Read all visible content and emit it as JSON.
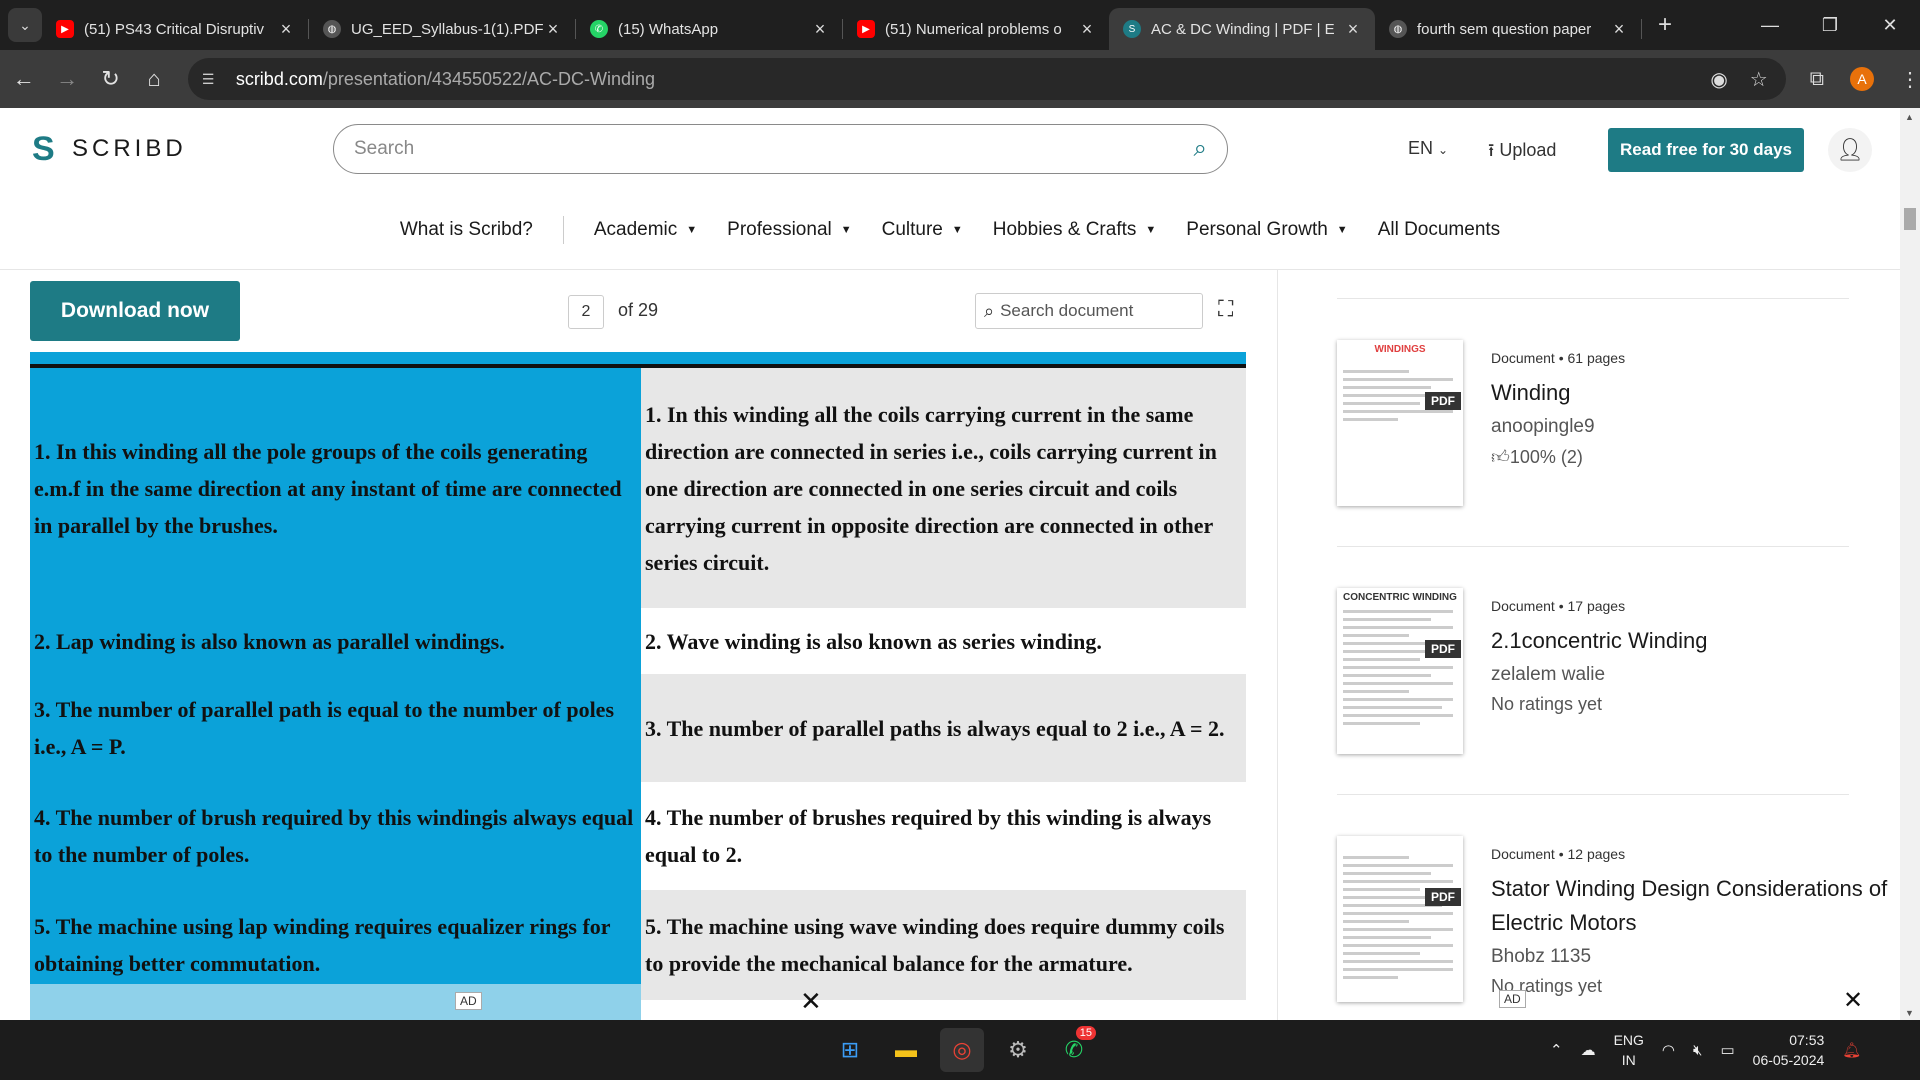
{
  "tabs": [
    {
      "title": "(51) PS43 Critical Disruptiv",
      "icon": "youtube-icon",
      "active": false
    },
    {
      "title": "UG_EED_Syllabus-1(1).PDF",
      "icon": "globe-icon",
      "active": false
    },
    {
      "title": "(15) WhatsApp",
      "icon": "whatsapp-icon",
      "active": false
    },
    {
      "title": "(51) Numerical problems o",
      "icon": "youtube-icon",
      "active": false
    },
    {
      "title": "AC & DC Winding | PDF | E",
      "icon": "scribd-icon",
      "active": true
    },
    {
      "title": "fourth sem question paper",
      "icon": "globe-icon",
      "active": false
    }
  ],
  "address": {
    "host": "scribd.com",
    "path": "/presentation/434550522/AC-DC-Winding"
  },
  "profile_initial": "A",
  "header": {
    "logo": "SCRIBD",
    "search_placeholder": "Search",
    "lang": "EN",
    "upload": "Upload",
    "read_free": "Read free for 30 days"
  },
  "nav": [
    "What is Scribd?",
    "Academic",
    "Professional",
    "Culture",
    "Hobbies & Crafts",
    "Personal Growth",
    "All Documents"
  ],
  "toolbar": {
    "download": "Download now",
    "page": "2",
    "of_pages": "of 29",
    "search_doc": "Search document"
  },
  "table": [
    {
      "left": "1. In this winding all the pole groups of the coils generating e.m.f in the same direction at any instant of time are connected in parallel by the brushes.",
      "right": "1. In this winding all the coils carrying current in the same direction are connected in series i.e., coils carrying current in one direction are connected in one series circuit and coils carrying current in opposite direction are connected in other series circuit."
    },
    {
      "left": "2. Lap winding is also known as parallel windings.",
      "right": "2. Wave winding is also known as series winding."
    },
    {
      "left": "3. The number of parallel path is equal to the number of poles i.e., A = P.",
      "right": "3. The number of parallel paths is always equal to 2 i.e., A = 2."
    },
    {
      "left": "4. The number of brush required by this windingis always equal to the number of poles.",
      "right": "4. The number of brushes required by this winding is always equal to 2."
    },
    {
      "left": "5. The machine using lap winding requires equalizer rings for obtaining better commutation.",
      "right": "5. The machine using wave winding does require dummy coils to provide the mechanical balance for the armature."
    }
  ],
  "ad_label": "AD",
  "related": [
    {
      "meta": "Document • 61 pages",
      "title": "Winding",
      "author": "anoopingle9",
      "rating": "100% (2)",
      "thumb_text": "WINDINGS"
    },
    {
      "meta": "Document • 17 pages",
      "title": "2.1concentric Winding",
      "author": "zelalem walie",
      "rating": "No ratings yet",
      "thumb_text": "CONCENTRIC WINDING"
    },
    {
      "meta": "Document • 12 pages",
      "title": "Stator Winding Design Considerations of Electric Motors",
      "author": "Bhobz 1135",
      "rating": "No ratings yet",
      "thumb_text": ""
    }
  ],
  "pdf_badge": "PDF",
  "taskbar": {
    "whatsapp_badge": "15",
    "lang": "ENG",
    "region": "IN",
    "time": "07:53",
    "date": "06-05-2024"
  }
}
